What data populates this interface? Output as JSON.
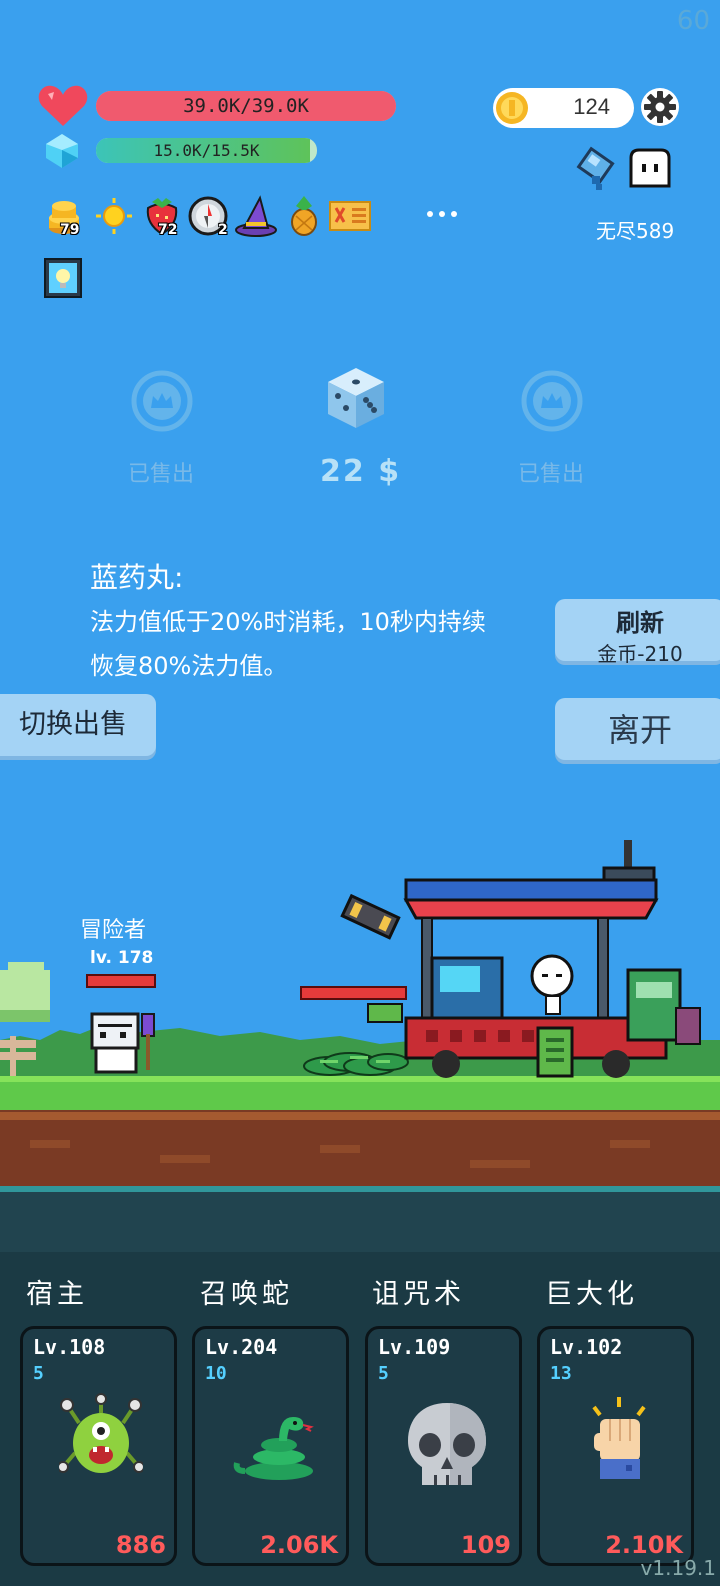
{
  "fps": "60",
  "hud": {
    "hp_text": "39.0K/39.0K",
    "hp_fraction": 1.0,
    "mp_text": "15.0K/15.5K",
    "mp_fraction": 0.97,
    "coins": "124",
    "mode_label": "无尽589"
  },
  "items": [
    {
      "icon": "gold-coin-stack-icon",
      "count": "79"
    },
    {
      "icon": "sun-icon",
      "count": ""
    },
    {
      "icon": "strawberry-icon",
      "count": "72"
    },
    {
      "icon": "compass-icon",
      "count": "2"
    },
    {
      "icon": "wizard-hat-icon",
      "count": ""
    },
    {
      "icon": "pineapple-icon",
      "count": ""
    },
    {
      "icon": "scroll-icon",
      "count": ""
    },
    {
      "icon": "more-icon",
      "count": ""
    },
    {
      "icon": "lightbulb-icon",
      "count": ""
    }
  ],
  "shop": {
    "slot_left_label": "已售出",
    "price": "22 $",
    "slot_right_label": "已售出"
  },
  "description": {
    "title": "蓝药丸:",
    "line1": "法力值低于20%时消耗，10秒内持续",
    "line2": "恢复80%法力值。"
  },
  "buttons": {
    "refresh_label": "刷新",
    "refresh_cost": "金币-210",
    "switch_label": "切换出售",
    "leave_label": "离开"
  },
  "scene": {
    "player_name": "冒险者",
    "player_level": "lv. 178"
  },
  "skills": [
    {
      "title": "宿主",
      "level": "Lv.108",
      "count": "5",
      "cost": "886",
      "icon": "green-monster-icon"
    },
    {
      "title": "召唤蛇",
      "level": "Lv.204",
      "count": "10",
      "cost": "2.06K",
      "icon": "snake-icon"
    },
    {
      "title": "诅咒术",
      "level": "Lv.109",
      "count": "5",
      "cost": "109",
      "icon": "skull-icon"
    },
    {
      "title": "巨大化",
      "level": "Lv.102",
      "count": "13",
      "cost": "2.10K",
      "icon": "fist-icon"
    }
  ],
  "version": "v1.19.1",
  "colors": {
    "sky": "#3aa0ee",
    "hp_bar": "#f05a6e",
    "mp_bar": "#52c36a",
    "cost_red": "#ff5b5b",
    "count_cyan": "#55d0ff"
  }
}
